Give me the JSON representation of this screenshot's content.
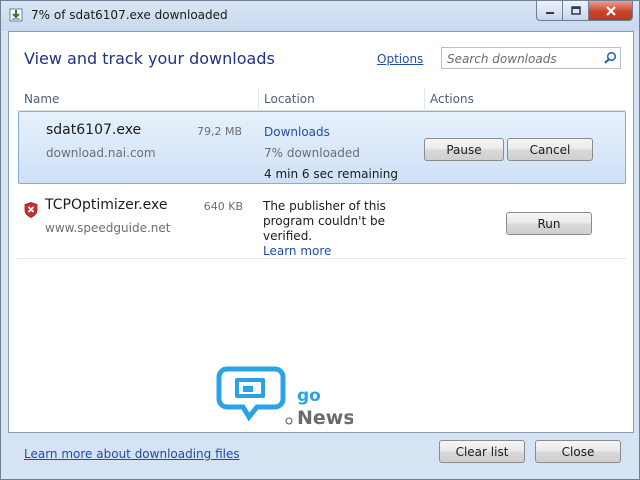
{
  "window": {
    "title": "7% of sdat6107.exe downloaded"
  },
  "header": {
    "title": "View and track your downloads",
    "options_label": "Options",
    "search_placeholder": "Search downloads"
  },
  "columns": {
    "name": "Name",
    "location": "Location",
    "actions": "Actions"
  },
  "downloads": [
    {
      "filename": "sdat6107.exe",
      "size": "79,2 MB",
      "source": "download.nai.com",
      "location_link": "Downloads",
      "progress_text": "7% downloaded",
      "progress_percent": 7,
      "time_remaining": "4 min 6 sec remaining",
      "actions": [
        "Pause",
        "Cancel"
      ]
    },
    {
      "filename": "TCPOptimizer.exe",
      "size": "640 KB",
      "source": "www.speedguide.net",
      "warning_lines": [
        "The publisher of this",
        "program couldn't be",
        "verified."
      ],
      "learn_more": "Learn more",
      "actions": [
        "Run"
      ],
      "icon": "shield-warning-icon"
    }
  ],
  "watermark": {
    "line1": "go",
    "line2": "News"
  },
  "footer": {
    "learn_more_link": "Learn more about downloading files",
    "clear_list_label": "Clear list",
    "close_label": "Close"
  },
  "colors": {
    "link": "#1f4ea8",
    "header_title": "#1e3287",
    "selected_row": "#cfe1f7",
    "logo_blue": "#2aa3e6"
  }
}
